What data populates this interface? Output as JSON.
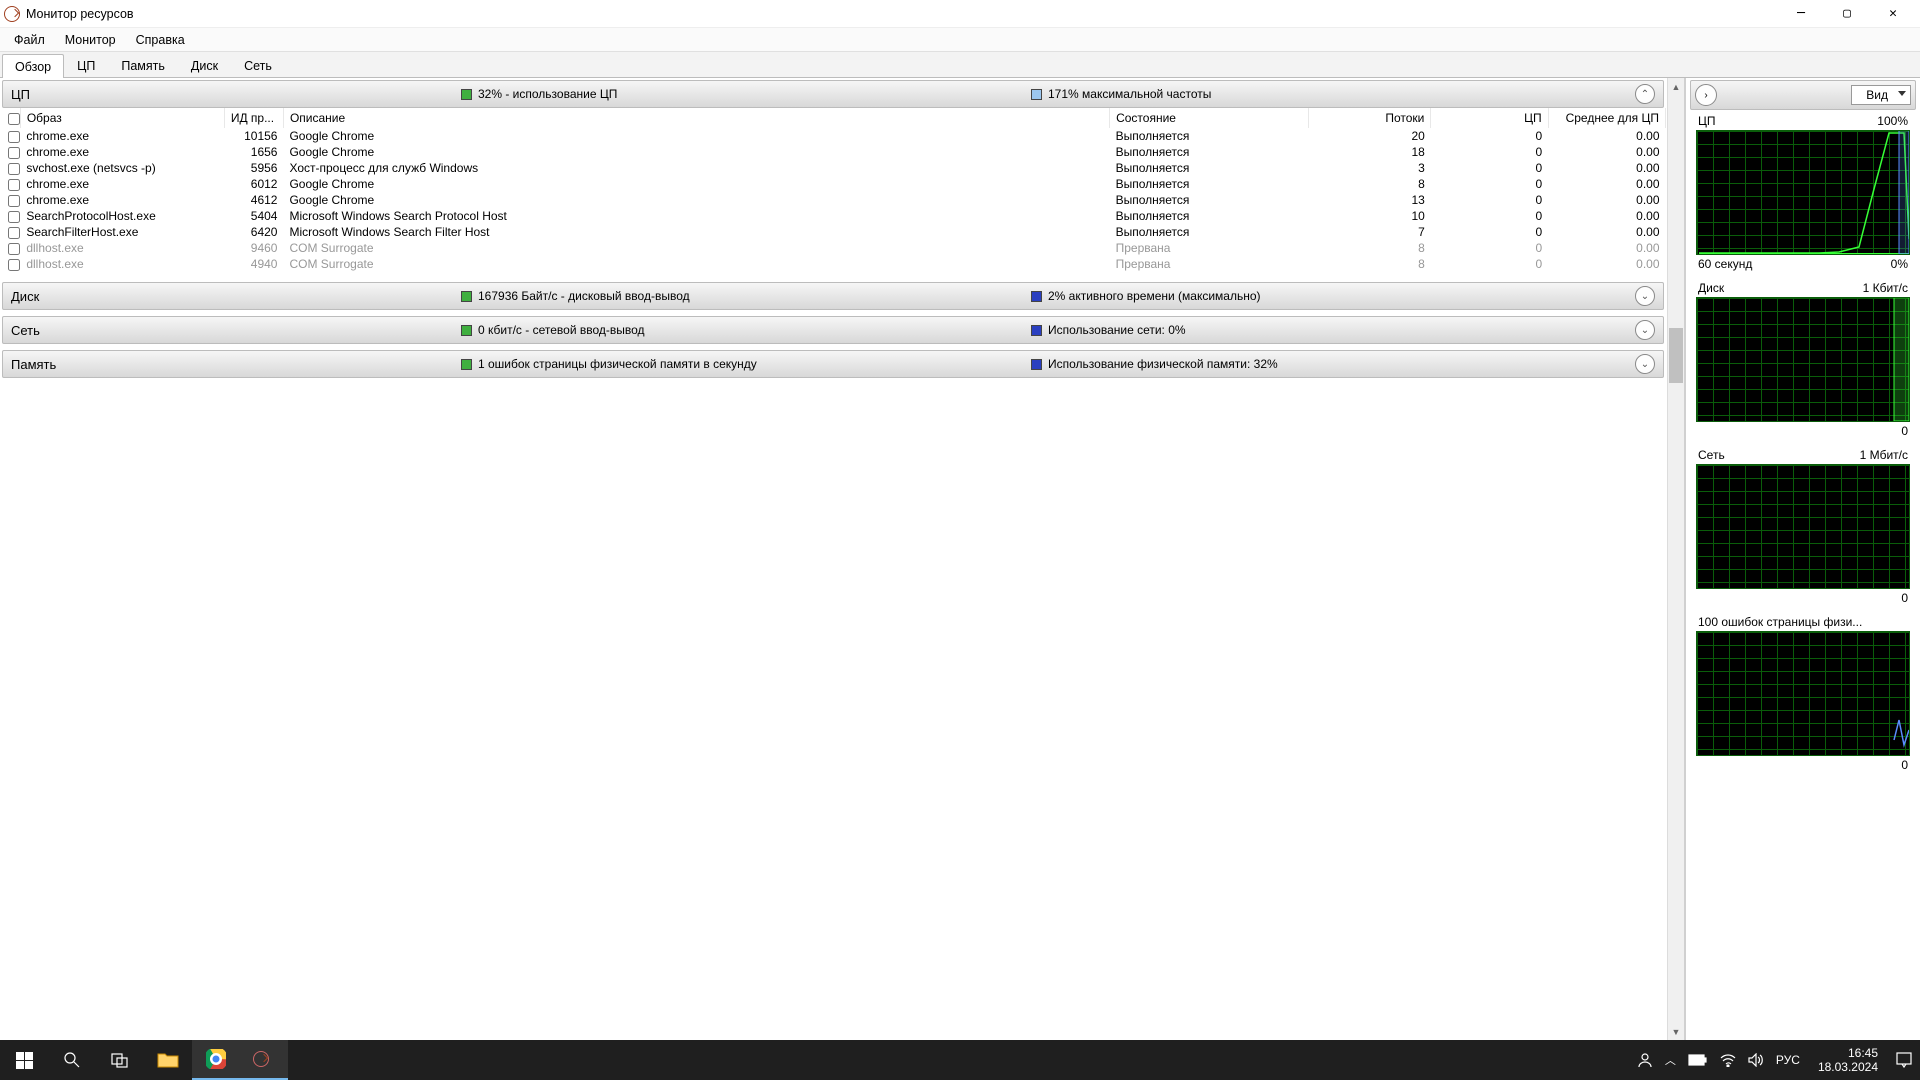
{
  "window": {
    "title": "Монитор ресурсов"
  },
  "menu": {
    "file": "Файл",
    "monitor": "Монитор",
    "help": "Справка"
  },
  "tabs": {
    "overview": "Обзор",
    "cpu": "ЦП",
    "memory": "Память",
    "disk": "Диск",
    "network": "Сеть"
  },
  "sections": {
    "cpu": {
      "title": "ЦП",
      "metric1": "32% - использование ЦП",
      "metric2": "171% максимальной частоты",
      "col1": "#3faf3f",
      "col2": "#4477dd"
    },
    "disk": {
      "title": "Диск",
      "metric1": "167936 Байт/с - дисковый ввод-вывод",
      "metric2": "2% активного времени (максимально)",
      "col1": "#3faf3f",
      "col2": "#2a3fc0"
    },
    "net": {
      "title": "Сеть",
      "metric1": "0 кбит/с - сетевой ввод-вывод",
      "metric2": "Использование сети: 0%",
      "col1": "#3faf3f",
      "col2": "#2a3fc0"
    },
    "memory": {
      "title": "Память",
      "metric1": "1 ошибок страницы физической памяти в секунду",
      "metric2": "Использование физической памяти: 32%",
      "col1": "#3faf3f",
      "col2": "#2a3fc0"
    }
  },
  "columns": {
    "image": "Образ",
    "pid": "ИД пр...",
    "desc": "Описание",
    "state": "Состояние",
    "threads": "Потоки",
    "cpu": "ЦП",
    "avg": "Среднее для ЦП"
  },
  "rows": [
    {
      "img": "chrome.exe",
      "pid": "10156",
      "desc": "Google Chrome",
      "state": "Выполняется",
      "threads": "20",
      "cpu": "0",
      "avg": "0.00",
      "susp": false
    },
    {
      "img": "chrome.exe",
      "pid": "1656",
      "desc": "Google Chrome",
      "state": "Выполняется",
      "threads": "18",
      "cpu": "0",
      "avg": "0.00",
      "susp": false
    },
    {
      "img": "svchost.exe (netsvcs -p)",
      "pid": "5956",
      "desc": "Хост-процесс для служб Windows",
      "state": "Выполняется",
      "threads": "3",
      "cpu": "0",
      "avg": "0.00",
      "susp": false
    },
    {
      "img": "chrome.exe",
      "pid": "6012",
      "desc": "Google Chrome",
      "state": "Выполняется",
      "threads": "8",
      "cpu": "0",
      "avg": "0.00",
      "susp": false
    },
    {
      "img": "chrome.exe",
      "pid": "4612",
      "desc": "Google Chrome",
      "state": "Выполняется",
      "threads": "13",
      "cpu": "0",
      "avg": "0.00",
      "susp": false
    },
    {
      "img": "SearchProtocolHost.exe",
      "pid": "5404",
      "desc": "Microsoft Windows Search Protocol Host",
      "state": "Выполняется",
      "threads": "10",
      "cpu": "0",
      "avg": "0.00",
      "susp": false
    },
    {
      "img": "SearchFilterHost.exe",
      "pid": "6420",
      "desc": "Microsoft Windows Search Filter Host",
      "state": "Выполняется",
      "threads": "7",
      "cpu": "0",
      "avg": "0.00",
      "susp": false
    },
    {
      "img": "dllhost.exe",
      "pid": "9460",
      "desc": "COM Surrogate",
      "state": "Прервана",
      "threads": "8",
      "cpu": "0",
      "avg": "0.00",
      "susp": true
    },
    {
      "img": "dllhost.exe",
      "pid": "4940",
      "desc": "COM Surrogate",
      "state": "Прервана",
      "threads": "8",
      "cpu": "0",
      "avg": "0.00",
      "susp": true
    }
  ],
  "rightPane": {
    "viewLabel": "Вид",
    "graphs": [
      {
        "topLeft": "ЦП",
        "topRight": "100%",
        "botLeft": "60 секунд",
        "botRight": "0%"
      },
      {
        "topLeft": "Диск",
        "topRight": "1 Кбит/с",
        "botLeft": "",
        "botRight": "0"
      },
      {
        "topLeft": "Сеть",
        "topRight": "1 Мбит/с",
        "botLeft": "",
        "botRight": "0"
      },
      {
        "topLeft": "100 ошибок страницы физи...",
        "topRight": "",
        "botLeft": "",
        "botRight": "0"
      }
    ]
  },
  "taskbar": {
    "lang": "РУС",
    "time": "16:45",
    "date": "18.03.2024"
  }
}
